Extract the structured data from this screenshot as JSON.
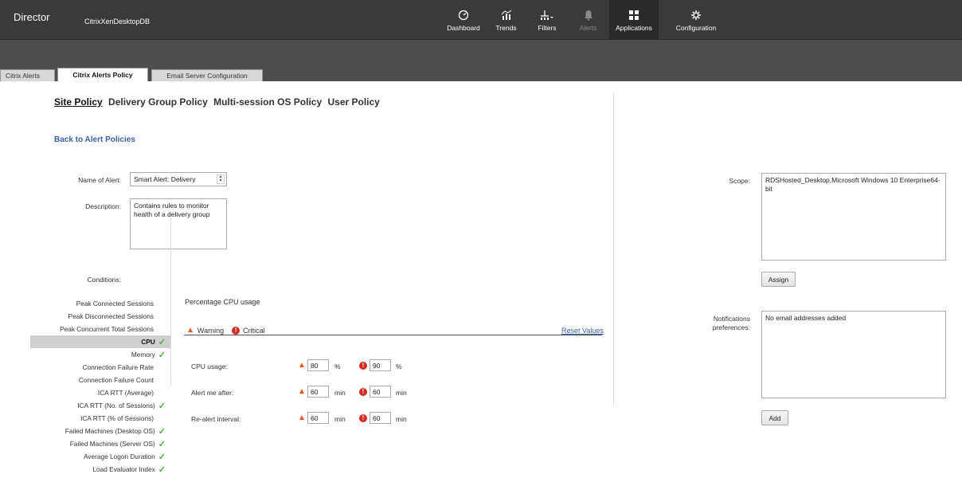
{
  "header": {
    "brand": "Director",
    "site": "CitrixXenDesktopDB",
    "nav": [
      {
        "label": "Dashboard",
        "icon": "dashboard-icon"
      },
      {
        "label": "Trends",
        "icon": "trends-icon"
      },
      {
        "label": "Filters",
        "icon": "filters-icon"
      },
      {
        "label": "Alerts",
        "icon": "bell-icon"
      },
      {
        "label": "Applications",
        "icon": "applications-icon"
      },
      {
        "label": "Configuration",
        "icon": "gear-icon"
      }
    ]
  },
  "tabs": [
    "Citrix Alerts",
    "Citrix Alerts Policy",
    "Email Server Configuration"
  ],
  "policy_tabs": [
    "Site Policy",
    "Delivery Group Policy",
    "Multi-session OS Policy",
    "User Policy"
  ],
  "back_link": "Back to Alert Policies",
  "form": {
    "name_label": "Name of Alert:",
    "name_value": "Smart Alert: Delivery",
    "description_label": "Description:",
    "description_value": "Contains rules to monitor health of a delivery group",
    "conditions_label": "Conditions:",
    "scope_label": "Scope:",
    "scope_value": "RDSHosted_Desktop,Microsoft Windows 10 Enterprise64-bit",
    "assign_label": "Assign",
    "notifications_label": "Notifications preferences:",
    "notifications_value": "No email addresses added",
    "add_label": "Add"
  },
  "conditions": [
    {
      "label": "Peak Connected Sessions",
      "checked": false
    },
    {
      "label": "Peak Disconnected Sessions",
      "checked": false
    },
    {
      "label": "Peak Concurrent Total Sessions",
      "checked": false
    },
    {
      "label": "CPU",
      "checked": true,
      "selected": true
    },
    {
      "label": "Memory",
      "checked": true
    },
    {
      "label": "Connection Failure Rate",
      "checked": false
    },
    {
      "label": "Connection Failure Count",
      "checked": false
    },
    {
      "label": "ICA RTT (Average)",
      "checked": false
    },
    {
      "label": "ICA RTT (No. of Sessions)",
      "checked": true
    },
    {
      "label": "ICA RTT (% of Sessions)",
      "checked": false
    },
    {
      "label": "Failed Machines (Desktop OS)",
      "checked": true
    },
    {
      "label": "Failed Machines (Server OS)",
      "checked": true
    },
    {
      "label": "Average Logon Duration",
      "checked": true
    },
    {
      "label": "Load Evaluator Index",
      "checked": true
    }
  ],
  "detail": {
    "title": "Percentage CPU usage",
    "warning_label": "Warning",
    "critical_label": "Critical",
    "reset_label": "Reset Values",
    "rows": [
      {
        "label": "CPU usage:",
        "warning": "80",
        "critical": "90",
        "unit": "%"
      },
      {
        "label": "Alert me after:",
        "warning": "60",
        "critical": "60",
        "unit": "min"
      },
      {
        "label": "Re-alert interval:",
        "warning": "60",
        "critical": "60",
        "unit": "min"
      }
    ]
  },
  "colors": {
    "topbar": "#3a3a3a",
    "link": "#3a5ea8",
    "check": "#4caf3a",
    "warning": "#e85a1c",
    "critical": "#d32b1f"
  }
}
